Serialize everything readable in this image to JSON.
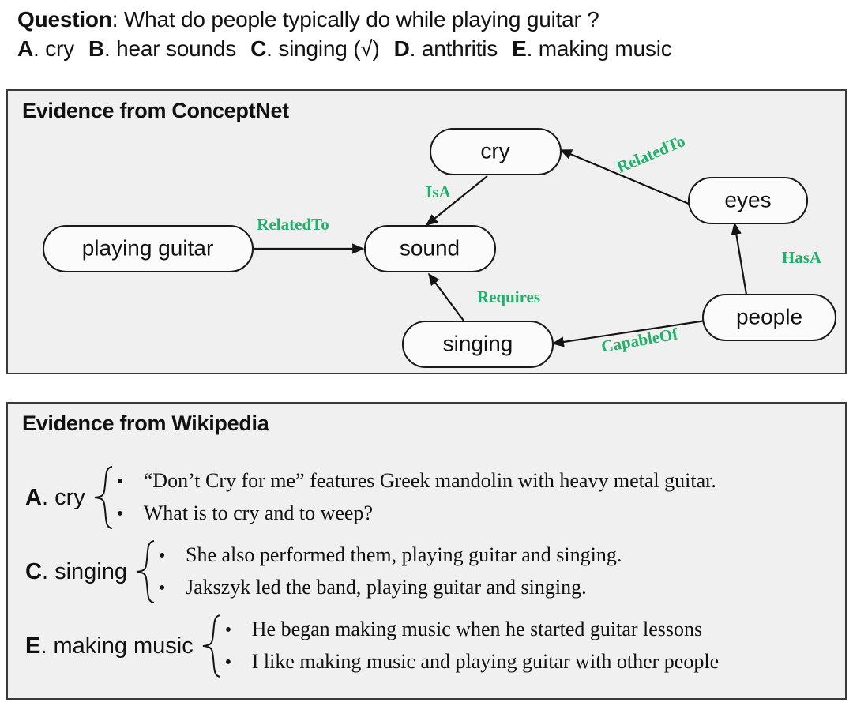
{
  "question": {
    "prefix_label": "Question",
    "separator": ": ",
    "text": "What do people typically do while playing guitar ?",
    "options": [
      {
        "letter": "A",
        "dot": ".",
        "text": "cry"
      },
      {
        "letter": "B",
        "dot": ".",
        "text": "hear sounds"
      },
      {
        "letter": "C",
        "dot": ".",
        "text": "singing (√)"
      },
      {
        "letter": "D",
        "dot": ".",
        "text": "anthritis"
      },
      {
        "letter": "E",
        "dot": ".",
        "text": "making music"
      }
    ]
  },
  "conceptnet": {
    "title": "Evidence from ConceptNet",
    "accent_color": "#22b06a",
    "node_fill": "#fbfbfb",
    "node_stroke": "#1a1a1a",
    "panel_bg": "#f0f0f0",
    "nodes": [
      {
        "id": "playing_guitar",
        "label": "playing guitar"
      },
      {
        "id": "cry",
        "label": "cry"
      },
      {
        "id": "sound",
        "label": "sound"
      },
      {
        "id": "eyes",
        "label": "eyes"
      },
      {
        "id": "people",
        "label": "people"
      },
      {
        "id": "singing",
        "label": "singing"
      }
    ],
    "edges": [
      {
        "from": "playing_guitar",
        "to": "sound",
        "label": "RelatedTo"
      },
      {
        "from": "cry",
        "to": "sound",
        "label": "IsA"
      },
      {
        "from": "eyes",
        "to": "cry",
        "label": "RelatedTo"
      },
      {
        "from": "people",
        "to": "eyes",
        "label": "HasA"
      },
      {
        "from": "people",
        "to": "singing",
        "label": "CapableOf"
      },
      {
        "from": "singing",
        "to": "sound",
        "label": "Requires"
      }
    ]
  },
  "wikipedia": {
    "title": "Evidence from Wikipedia",
    "bullet_glyph": "•",
    "groups": [
      {
        "letter": "A",
        "dot": ".",
        "choice": "cry",
        "bullets": [
          "“Don’t Cry for me” features Greek mandolin with heavy metal guitar.",
          "What is to cry and to weep?"
        ]
      },
      {
        "letter": "C",
        "dot": ".",
        "choice": "singing",
        "bullets": [
          "She also performed them, playing guitar and singing.",
          "Jakszyk led the band, playing guitar and singing."
        ]
      },
      {
        "letter": "E",
        "dot": ".",
        "choice": "making music",
        "bullets": [
          "He began making music when he started guitar lessons",
          "I like making music and playing guitar with other people"
        ]
      }
    ]
  }
}
